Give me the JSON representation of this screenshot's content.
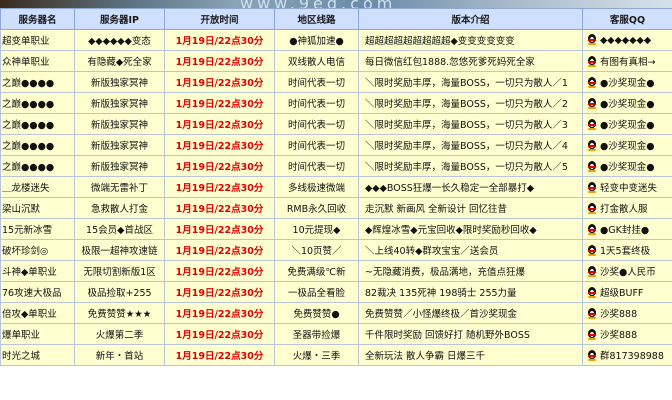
{
  "banner": {
    "text": "www.9ed.com"
  },
  "headers": [
    "服务器名",
    "服务器IP",
    "开放时间",
    "地区线路",
    "版本介绍",
    "客服QQ"
  ],
  "rows": [
    {
      "name": "超变单职业",
      "ip": "◆◆◆◆◆◆变态",
      "time": "1月19日/22点30分",
      "line": "●神狐加速●",
      "desc": "超超超超超超超超超◆变变变变变变",
      "qq": "◆◆◆◆◆◆◆"
    },
    {
      "name": "众神单职业",
      "ip": "有隐藏◆死全家",
      "time": "1月19日/22点30分",
      "line": "双线散人电信",
      "desc": "每日微信红包1888.忽悠死爹死妈死全家",
      "qq": "有图有真相→"
    },
    {
      "name": "之巅●●●●",
      "ip": "新版独家冥神",
      "time": "1月19日/22点30分",
      "line": "时间代表一切",
      "desc": "＼限时奖励丰厚，海量BOSS，一切只为散人／1",
      "qq": "●沙奖现金●"
    },
    {
      "name": "之巅●●●●",
      "ip": "新版独家冥神",
      "time": "1月19日/22点30分",
      "line": "时间代表一切",
      "desc": "＼限时奖励丰厚，海量BOSS，一切只为散人／2",
      "qq": "●沙奖现金●"
    },
    {
      "name": "之巅●●●●",
      "ip": "新版独家冥神",
      "time": "1月19日/22点30分",
      "line": "时间代表一切",
      "desc": "＼限时奖励丰厚，海量BOSS，一切只为散人／3",
      "qq": "●沙奖现金●"
    },
    {
      "name": "之巅●●●●",
      "ip": "新版独家冥神",
      "time": "1月19日/22点30分",
      "line": "时间代表一切",
      "desc": "＼限时奖励丰厚，海量BOSS，一切只为散人／4",
      "qq": "●沙奖现金●"
    },
    {
      "name": "之巅●●●●",
      "ip": "新版独家冥神",
      "time": "1月19日/22点30分",
      "line": "时间代表一切",
      "desc": "＼限时奖励丰厚，海量BOSS，一切只为散人／5",
      "qq": "●沙奖现金●"
    },
    {
      "name": "＿龙楼迷失",
      "ip": "微端无雷补丁",
      "time": "1月19日/22点30分",
      "line": "多线极速微端",
      "desc": "◆◆◆BOSS狂爆一长久稳定一全部暴打◆",
      "qq": "轻变中变迷失"
    },
    {
      "name": "梁山沉默",
      "ip": "急救散人打金",
      "time": "1月19日/22点30分",
      "line": "RMB永久回收",
      "desc": "走沉默 新画风 全新设计 回忆往昔",
      "qq": "打金散人服"
    },
    {
      "name": "15元新冰雪",
      "ip": "15会员◆首战区",
      "time": "1月19日/22点30分",
      "line": "10元提现◆",
      "desc": "◆辉煌冰雪◆元宝回收◆限时奖励秒回收◆",
      "qq": "●GK封挂●"
    },
    {
      "name": "破坏珍剑◎",
      "ip": "极限一超神攻速链",
      "time": "1月19日/22点30分",
      "line": "＼10页赞／",
      "desc": "＼上线40转◆群攻宝宝／送会员",
      "qq": "1天5套终极"
    },
    {
      "name": "斗神◆单职业",
      "ip": "无限切割新版1区",
      "time": "1月19日/22点30分",
      "line": "免费满级℃新",
      "desc": "~无隐藏消费，极品满地，充值点狂爆",
      "qq": "沙奖●人民币"
    },
    {
      "name": "76攻速大极品",
      "ip": "极品捡取+255",
      "time": "1月19日/22点30分",
      "line": "一极品全看脸",
      "desc": "82裁决 135死神 198骑士 255力量",
      "qq": "超级BUFF"
    },
    {
      "name": "倍攻◆单职业",
      "ip": "免费赞赞★★★",
      "time": "1月19日/22点30分",
      "line": "免费赞赞●",
      "desc": "免费赞赞／小怪爆终极／首沙奖现金",
      "qq": "沙奖888"
    },
    {
      "name": "爆单职业",
      "ip": "火爆第二季",
      "time": "1月19日/22点30分",
      "line": "圣器带捡爆",
      "desc": "千件限时奖励 回馈好打 随机野外BOSS",
      "qq": "沙奖888"
    },
    {
      "name": "时光之城",
      "ip": "新年・首站",
      "time": "1月19日/22点30分",
      "line": "火爆・三季",
      "desc": "全新玩法 散人争霸 日爆三千",
      "qq": "群817398988"
    }
  ]
}
